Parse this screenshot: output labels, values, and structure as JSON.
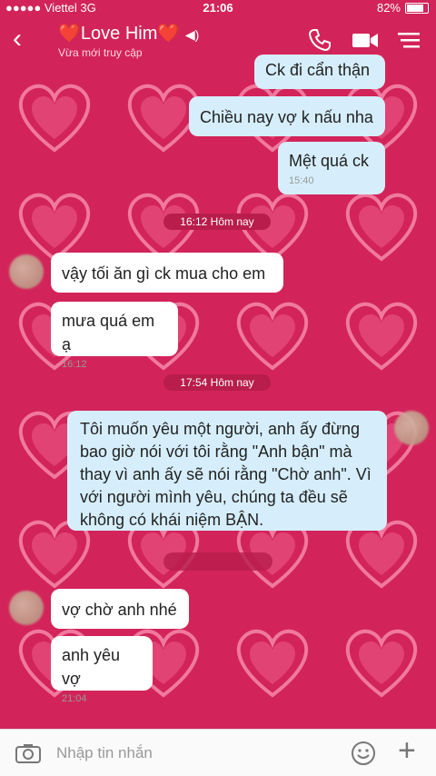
{
  "status": {
    "carrier": "●●●●● Viettel 3G",
    "time": "21:06",
    "battery": "82%"
  },
  "header": {
    "title": "❤️Love Him❤️",
    "subtitle": "Vừa mới truy cập"
  },
  "messages": {
    "m1": "Ck đi cẩn thận",
    "m2": "Chiều nay vợ k nấu nha",
    "m3": "Mệt quá ck",
    "m3_time": "15:40",
    "div1": "16:12 Hôm nay",
    "m4": "vậy tối ăn gì ck mua cho em",
    "m5": "mưa quá em ạ",
    "m5_time": "16:12",
    "div2": "17:54 Hôm nay",
    "m6": "Tôi muốn yêu một người, anh ấy đừng bao giờ nói với tôi rằng \"Anh bận\" mà thay vì anh ấy sẽ nói rằng \"Chờ anh\". Vì với người mình yêu, chúng ta đều sẽ không có khái niệm BẬN.",
    "m7": "vợ chờ anh nhé",
    "m8": "anh yêu vợ",
    "m8_time": "21:04"
  },
  "composer": {
    "placeholder": "Nhập tin nhắn"
  },
  "colors": {
    "background": "#d2245a",
    "outgoing": "#d6eefb",
    "incoming": "#ffffff"
  },
  "icons": [
    "back-arrow-icon",
    "speaker-icon",
    "phone-icon",
    "video-camera-icon",
    "menu-icon",
    "camera-icon",
    "emoji-icon",
    "plus-icon"
  ]
}
